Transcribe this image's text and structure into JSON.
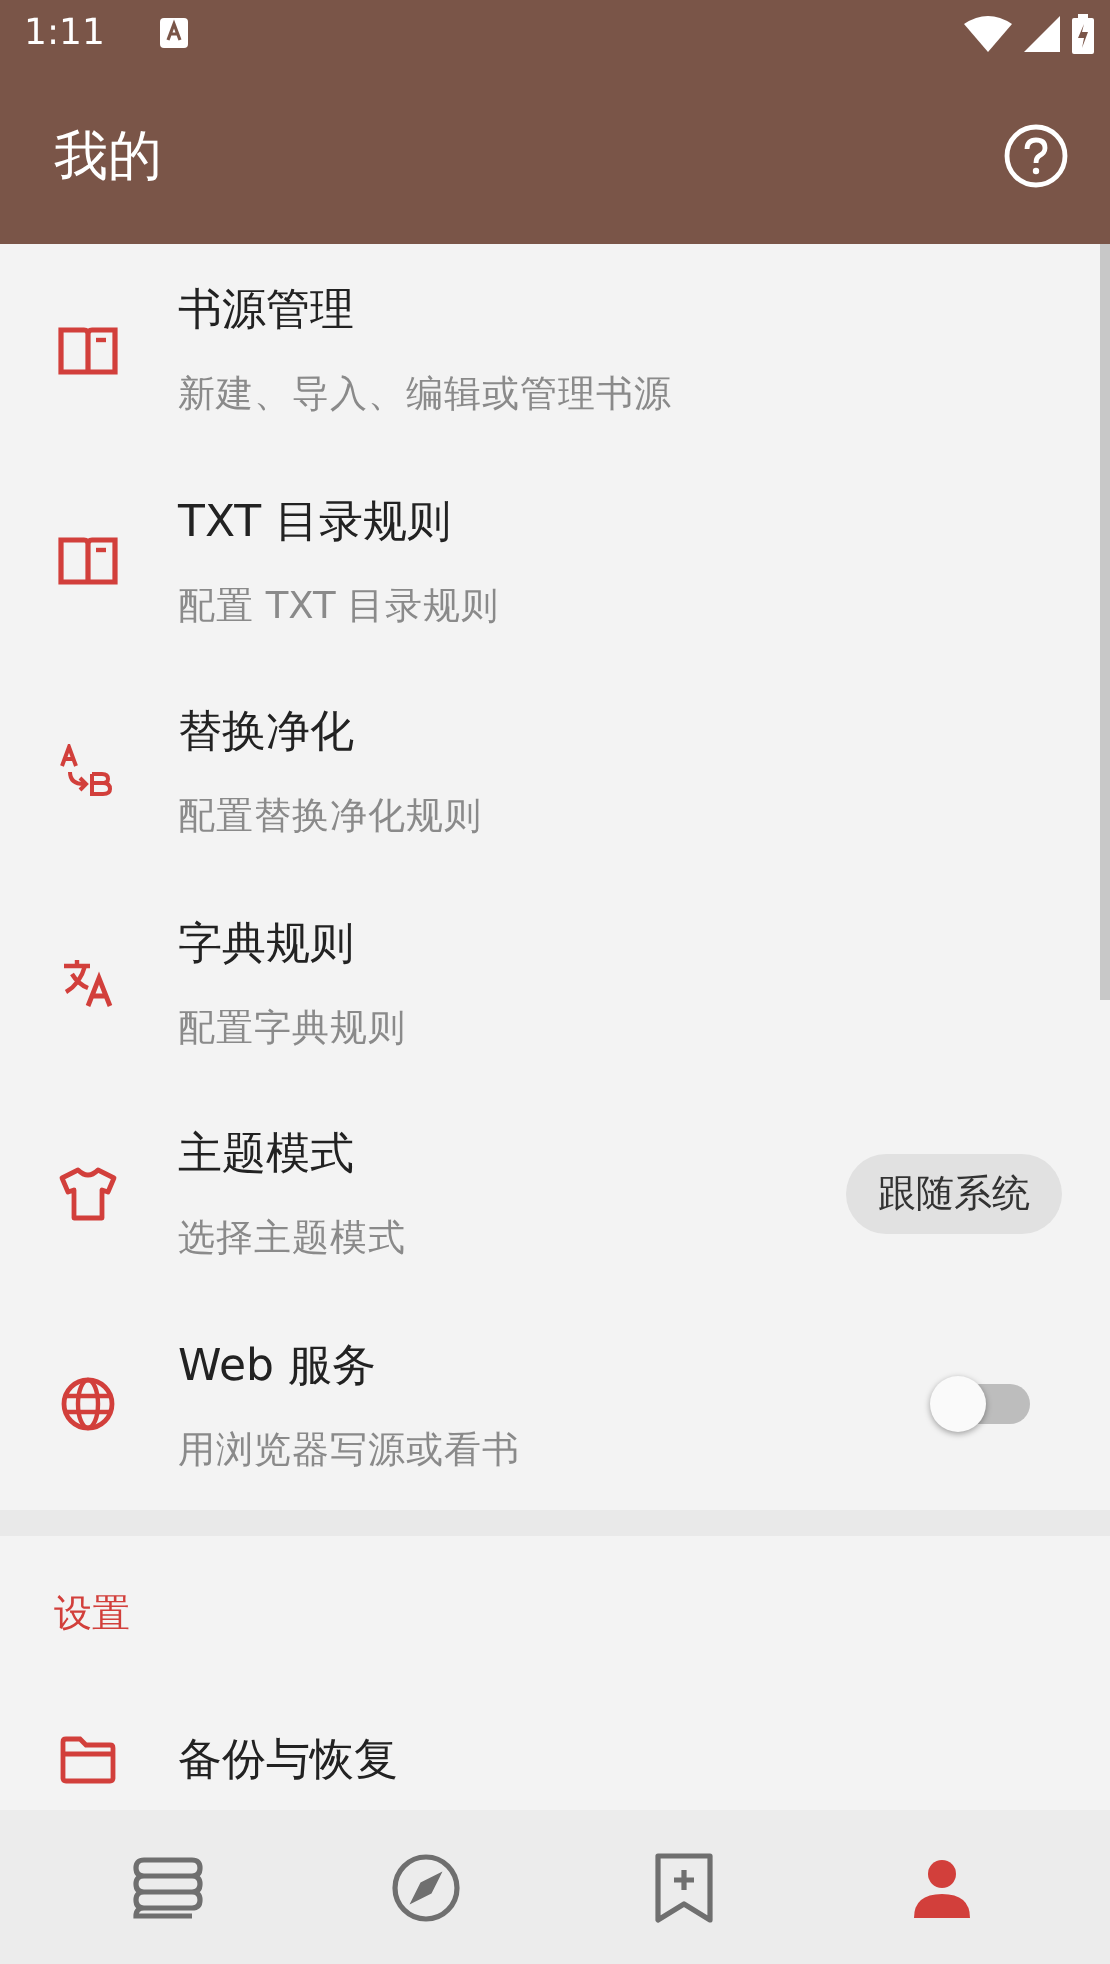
{
  "status_bar": {
    "time": "1:11"
  },
  "toolbar": {
    "title": "我的"
  },
  "items": [
    {
      "kind": "plain",
      "title": "书源管理",
      "subtitle": "新建、导入、编辑或管理书源"
    },
    {
      "kind": "plain",
      "title": "TXT 目录规则",
      "subtitle": "配置 TXT 目录规则"
    },
    {
      "kind": "plain",
      "title": "替换净化",
      "subtitle": "配置替换净化规则"
    },
    {
      "kind": "plain",
      "title": "字典规则",
      "subtitle": "配置字典规则"
    },
    {
      "kind": "chip",
      "title": "主题模式",
      "subtitle": "选择主题模式",
      "value": "跟随系统"
    },
    {
      "kind": "switch",
      "title": "Web 服务",
      "subtitle": "用浏览器写源或看书",
      "on": false
    }
  ],
  "settings": {
    "header": "设置",
    "items": [
      {
        "title": "备份与恢复"
      }
    ]
  },
  "bottom_nav": [
    {
      "selected": false
    },
    {
      "selected": false
    },
    {
      "selected": false
    },
    {
      "selected": true
    }
  ]
}
